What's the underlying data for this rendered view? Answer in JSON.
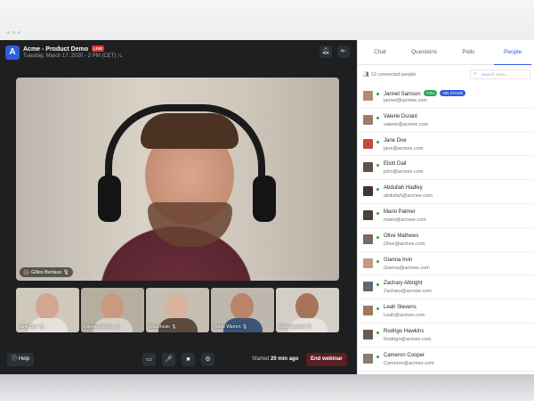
{
  "app": {
    "logo": "A",
    "title": "Acme - Product Demo",
    "live_badge": "LIVE",
    "subtitle": "Tuesday, March 17, 2020 - 2 PM (CET)",
    "icons": {
      "notifications": "bell-icon",
      "leave": "exit-icon"
    }
  },
  "main_video": {
    "speaker": "Gilles Bertaux"
  },
  "thumbnails": [
    {
      "name": "Jane Doe",
      "skin": "#d2a690",
      "shirt": "#e6e1d9",
      "bg": "#cfc8bd"
    },
    {
      "name": "Damien Verron",
      "skin": "#c99a80",
      "shirt": "#d7d2c9",
      "bg": "#b7aea2"
    },
    {
      "name": "Elsa Boulo",
      "skin": "#d8b39d",
      "shirt": "#5b4a3e",
      "bg": "#c5beb2"
    },
    {
      "name": "Wade Warren",
      "skin": "#b98468",
      "shirt": "#3c5478",
      "bg": "#bdb7ae"
    },
    {
      "name": "Elise Dupond",
      "skin": "#a87458",
      "shirt": "#e6e2dc",
      "bg": "#d3cec6"
    }
  ],
  "footer": {
    "help_label": "Help",
    "started_prefix": "Started",
    "started_time": "20 min ago",
    "end_label": "End webinar"
  },
  "panel": {
    "tabs": [
      "Chat",
      "Questions",
      "Polls",
      "People"
    ],
    "active_tab": 3,
    "connected": "12 connected people",
    "search_placeholder": "Search name...",
    "you_badge": "YOU",
    "stage_badge": "ON STAGE",
    "people": [
      {
        "name": "Jannet Samson",
        "email": "jannet@acmee.com",
        "color": "#b88870"
      },
      {
        "name": "Valerie Durant",
        "email": "valerie@acmee.com",
        "color": "#9a7c68"
      },
      {
        "name": "Jane Doe",
        "email": "jane@acmee.com",
        "color": "#c44a3a"
      },
      {
        "name": "Eliott Dail",
        "email": "john@acmee.com",
        "color": "#5c5248"
      },
      {
        "name": "Abdullah Hadley",
        "email": "abdullah@acmee.com",
        "color": "#3e3630"
      },
      {
        "name": "Mario Palmer",
        "email": "mario@acmee.com",
        "color": "#4b423a"
      },
      {
        "name": "Olive Mathews",
        "email": "Olive@acmee.com",
        "color": "#7b6a5d"
      },
      {
        "name": "Gianna Irvin",
        "email": "Gianna@acmee.com",
        "color": "#c39a86"
      },
      {
        "name": "Zachary Albright",
        "email": "Zachary@acmee.com",
        "color": "#5f6a74"
      },
      {
        "name": "Leah Stevens",
        "email": "Leah@acmee.com",
        "color": "#a07860"
      },
      {
        "name": "Rodrigo Hawkins",
        "email": "Rodrigo@acmee.com",
        "color": "#6d5a4e"
      },
      {
        "name": "Cameron Cooper",
        "email": "Cameron@acmee.com",
        "color": "#8a7a70"
      }
    ]
  }
}
